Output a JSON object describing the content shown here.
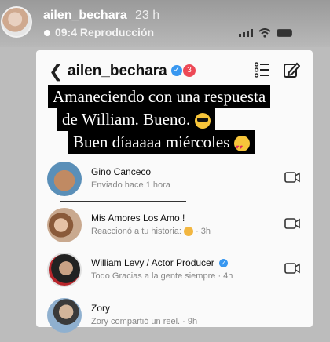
{
  "story": {
    "username": "ailen_bechara",
    "time": "23 h",
    "audio_label": "Reproducción",
    "clock": "09:4"
  },
  "header": {
    "username": "ailen_bechara",
    "notification_count": "3"
  },
  "caption": {
    "line1": "Amaneciendo con una respuesta",
    "line2": "de William. Bueno.",
    "line3": "Buen díaaaaa miércoles"
  },
  "messages": [
    {
      "name": "Gino Canceco",
      "meta": "Enviado hace 1 hora",
      "time": ""
    },
    {
      "name": "Mis Amores Los Amo !",
      "meta": "Reaccionó a tu historia:",
      "time": "· 3h"
    },
    {
      "name": "William  Levy / Actor Producer",
      "meta": "Todo Gracias a la gente siempre",
      "time": "· 4h"
    },
    {
      "name": "Zory",
      "meta": "Zory compartió un reel.",
      "time": "· 9h"
    }
  ],
  "colors": {
    "verified": "#3897f0",
    "badge": "#ed4956",
    "caption_bg": "#000000"
  }
}
